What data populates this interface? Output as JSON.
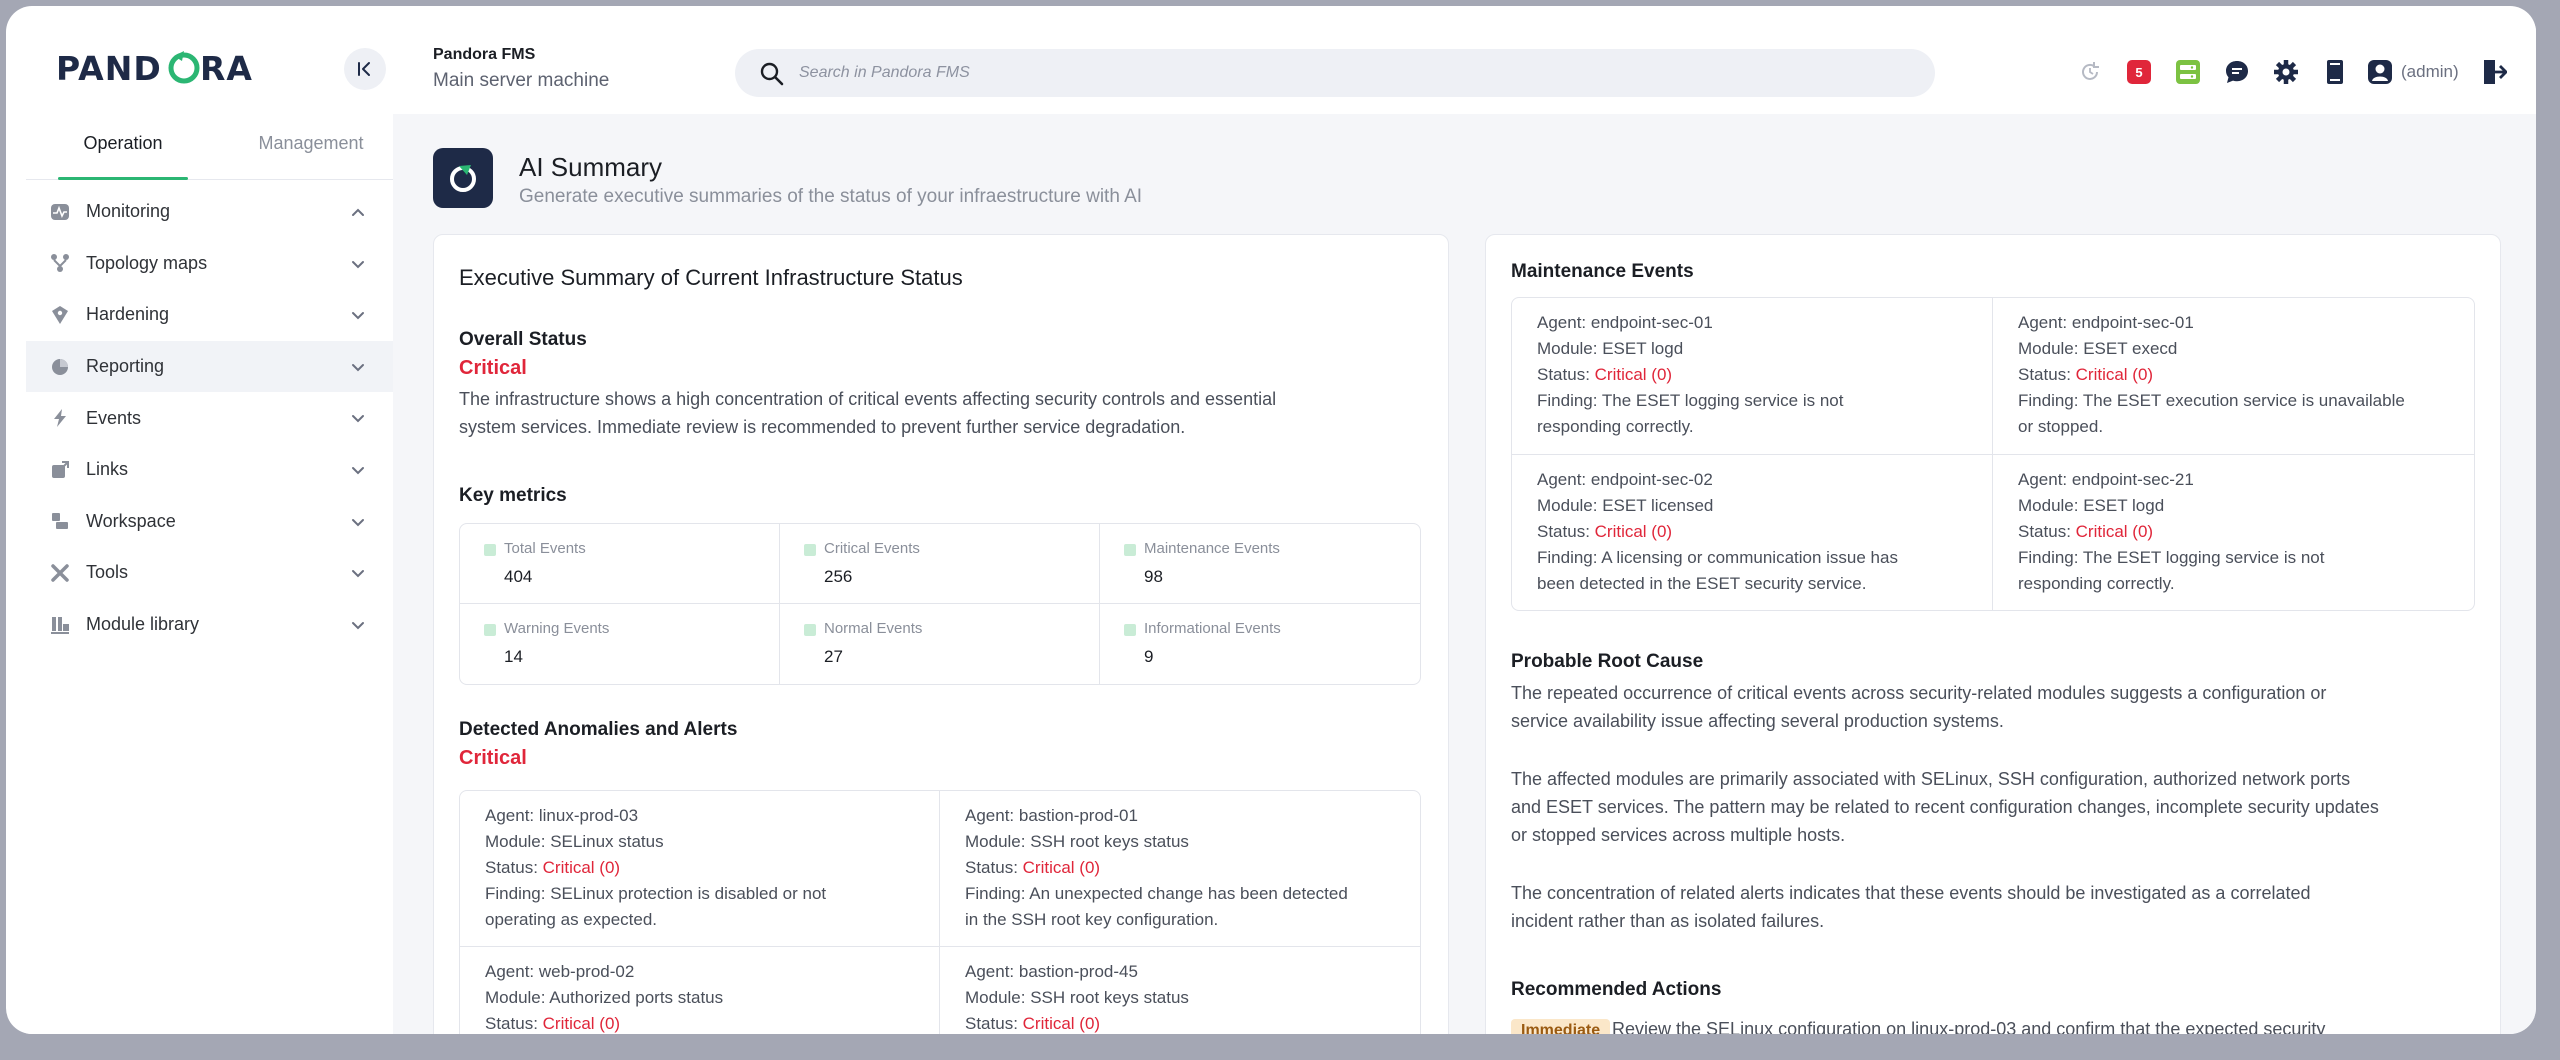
{
  "brand": {
    "logo_text": "PANDORA"
  },
  "sidebar": {
    "tabs": {
      "operation": "Operation",
      "management": "Management"
    },
    "items": [
      {
        "label": "Monitoring",
        "icon": "monitoring-icon",
        "expanded": true
      },
      {
        "label": "Topology maps",
        "icon": "topology-icon",
        "expanded": false
      },
      {
        "label": "Hardening",
        "icon": "hardening-icon",
        "expanded": false
      },
      {
        "label": "Reporting",
        "icon": "reporting-icon",
        "expanded": false,
        "active": true
      },
      {
        "label": "Events",
        "icon": "events-icon",
        "expanded": false
      },
      {
        "label": "Links",
        "icon": "links-icon",
        "expanded": false
      },
      {
        "label": "Workspace",
        "icon": "workspace-icon",
        "expanded": false
      },
      {
        "label": "Tools",
        "icon": "tools-icon",
        "expanded": false
      },
      {
        "label": "Module library",
        "icon": "module-library-icon",
        "expanded": false
      }
    ]
  },
  "header": {
    "app_name": "Pandora FMS",
    "server_name": "Main server machine",
    "search_placeholder": "Search in Pandora FMS",
    "alert_count": "5",
    "user_label": "(admin)"
  },
  "page": {
    "title": "AI Summary",
    "subtitle": "Generate executive summaries of the status of your infraestructure with AI"
  },
  "summary": {
    "heading": "Executive Summary of Current Infrastructure Status",
    "overall_heading": "Overall Status",
    "overall_status": "Critical",
    "overall_text_1": "The infrastructure shows a high concentration of critical events affecting security controls and essential",
    "overall_text_2": "system services. Immediate review is recommended to prevent further service degradation.",
    "metrics_heading": "Key metrics",
    "metrics": [
      {
        "label": "Total Events",
        "value": "404"
      },
      {
        "label": "Critical Events",
        "value": "256"
      },
      {
        "label": "Maintenance Events",
        "value": "98"
      },
      {
        "label": "Warning Events",
        "value": "14"
      },
      {
        "label": "Normal Events",
        "value": "27"
      },
      {
        "label": "Informational Events",
        "value": "9"
      }
    ],
    "anomalies_heading": "Detected Anomalies and Alerts",
    "anomalies_status": "Critical",
    "anomalies": [
      {
        "agent": "Agent: linux-prod-03",
        "module": "Module: SELinux status",
        "status_label": "Status: ",
        "status": "Critical (0)",
        "finding_1": "Finding: SELinux protection is disabled or not",
        "finding_2": "operating as expected."
      },
      {
        "agent": "Agent: bastion-prod-01",
        "module": "Module: SSH root keys status",
        "status_label": "Status: ",
        "status": "Critical (0)",
        "finding_1": "Finding: An unexpected change has been detected",
        "finding_2": "in the SSH root key configuration."
      },
      {
        "agent": "Agent: web-prod-02",
        "module": "Module: Authorized ports status",
        "status_label": "Status: ",
        "status": "Critical (0)",
        "finding_1": "",
        "finding_2": ""
      },
      {
        "agent": "Agent: bastion-prod-45",
        "module": "Module: SSH root keys status",
        "status_label": "Status: ",
        "status": "Critical (0)",
        "finding_1": "",
        "finding_2": ""
      }
    ]
  },
  "maintenance": {
    "heading": "Maintenance Events",
    "items": [
      {
        "agent": "Agent: endpoint-sec-01",
        "module": "Module: ESET logd",
        "status_label": "Status: ",
        "status": "Critical (0)",
        "finding_1": "Finding: The ESET logging service is not",
        "finding_2": "responding correctly."
      },
      {
        "agent": "Agent: endpoint-sec-01",
        "module": "Module: ESET execd",
        "status_label": "Status: ",
        "status": "Critical (0)",
        "finding_1": "Finding: The ESET execution service is unavailable",
        "finding_2": "or stopped."
      },
      {
        "agent": "Agent: endpoint-sec-02",
        "module": "Module: ESET licensed",
        "status_label": "Status: ",
        "status": "Critical (0)",
        "finding_1": "Finding: A licensing or communication issue has",
        "finding_2": "been detected in the ESET security service."
      },
      {
        "agent": "Agent: endpoint-sec-21",
        "module": "Module: ESET logd",
        "status_label": "Status: ",
        "status": "Critical (0)",
        "finding_1": "Finding: The ESET logging service is not",
        "finding_2": "responding correctly."
      }
    ]
  },
  "root_cause": {
    "heading": "Probable Root Cause",
    "p1_1": "The repeated occurrence of critical events across security-related modules suggests a configuration or",
    "p1_2": "service availability issue affecting several production systems.",
    "p2_1": "The affected modules are primarily associated with SELinux, SSH configuration, authorized network ports",
    "p2_2": "and ESET services. The pattern may be related to recent configuration changes, incomplete security updates",
    "p2_3": "or stopped services across multiple hosts.",
    "p3_1": "The concentration of related alerts indicates that these events should be investigated as a correlated",
    "p3_2": "incident rather than as isolated failures."
  },
  "actions": {
    "heading": "Recommended Actions",
    "tag": "Immediate",
    "first": "Review the SELinux configuration on linux-prod-03 and confirm that the expected security"
  },
  "colors": {
    "accent": "#2bb673",
    "critical": "#e0263a",
    "brand_dark": "#1e2a47"
  }
}
